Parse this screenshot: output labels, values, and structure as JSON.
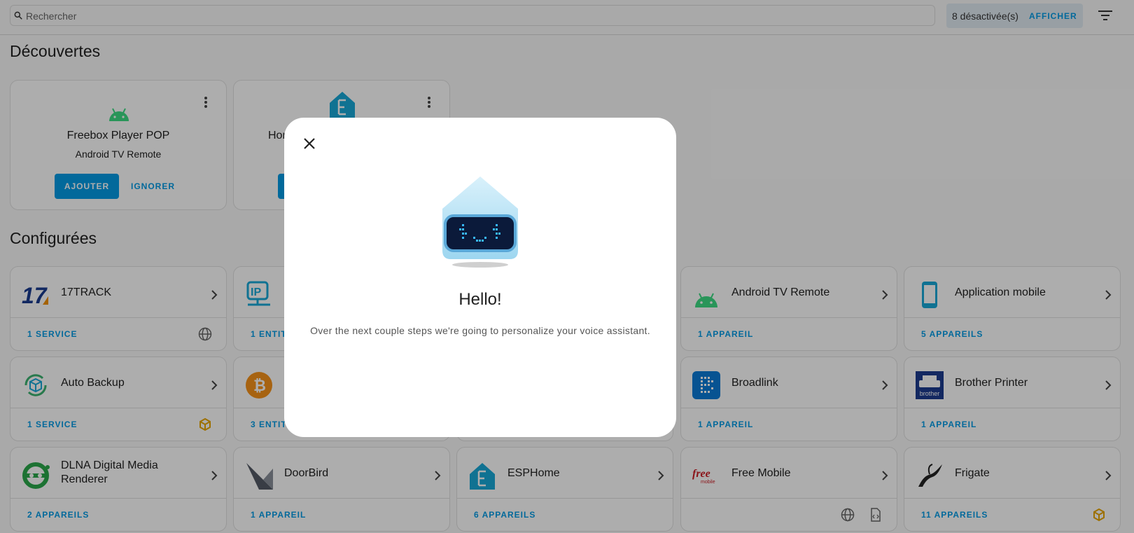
{
  "search": {
    "placeholder": "Rechercher"
  },
  "filters": {
    "disabled_count_label": "8 désactivée(s)",
    "show_label": "AFFICHER"
  },
  "discovered": {
    "title": "Découvertes",
    "cards": [
      {
        "name": "Freebox Player POP",
        "integration": "Android TV Remote",
        "add_label": "AJOUTER",
        "ignore_label": "IGNORER",
        "icon": "android-icon"
      },
      {
        "name": "Hor",
        "integration": "",
        "icon": "esphome-icon"
      }
    ]
  },
  "configured": {
    "title": "Configurées",
    "cards": [
      {
        "name": "17TRACK",
        "count": "1 SERVICE",
        "icon": "17track-logo",
        "badge": "globe-icon"
      },
      {
        "name": "",
        "count": "1 ENTIT",
        "icon": "ip-network-icon"
      },
      {
        "name": "Android TV Remote",
        "count": "1 APPAREIL",
        "icon": "android-icon"
      },
      {
        "name": "Application mobile",
        "count": "5 APPAREILS",
        "icon": "mobile-phone-icon"
      },
      {
        "name": "Auto Backup",
        "count": "1 SERVICE",
        "icon": "auto-backup-icon",
        "badge": "cube-icon"
      },
      {
        "name": "",
        "count": "3 ENTIT",
        "icon": "bitcoin-icon"
      },
      {
        "name": "Broadlink",
        "count": "1 APPAREIL",
        "icon": "broadlink-icon"
      },
      {
        "name": "Brother Printer",
        "count": "1 APPAREIL",
        "icon": "brother-printer-icon",
        "logo_text": "brother"
      },
      {
        "name": "DLNA Digital Media Renderer",
        "count": "2 APPAREILS",
        "icon": "dlna-icon"
      },
      {
        "name": "DoorBird",
        "count": "1 APPAREIL",
        "icon": "doorbird-icon"
      },
      {
        "name": "ESPHome",
        "count": "6 APPAREILS",
        "icon": "esphome-icon"
      },
      {
        "name": "Free Mobile",
        "count": "",
        "icon": "free-mobile-logo",
        "logo_text": "free mobile",
        "badges": [
          "globe-icon",
          "code-file-icon"
        ]
      },
      {
        "name": "Frigate",
        "count": "11 APPAREILS",
        "icon": "frigate-icon",
        "badge": "cube-icon"
      }
    ]
  },
  "dialog": {
    "title": "Hello!",
    "description": "Over the next couple steps we're going to personalize your voice assistant.",
    "icons": {
      "close": "close-icon",
      "mascot": "voice-assistant-mascot"
    }
  },
  "colors": {
    "accent": "#039be5",
    "overlay": "rgba(0,0,0,0.32)"
  }
}
